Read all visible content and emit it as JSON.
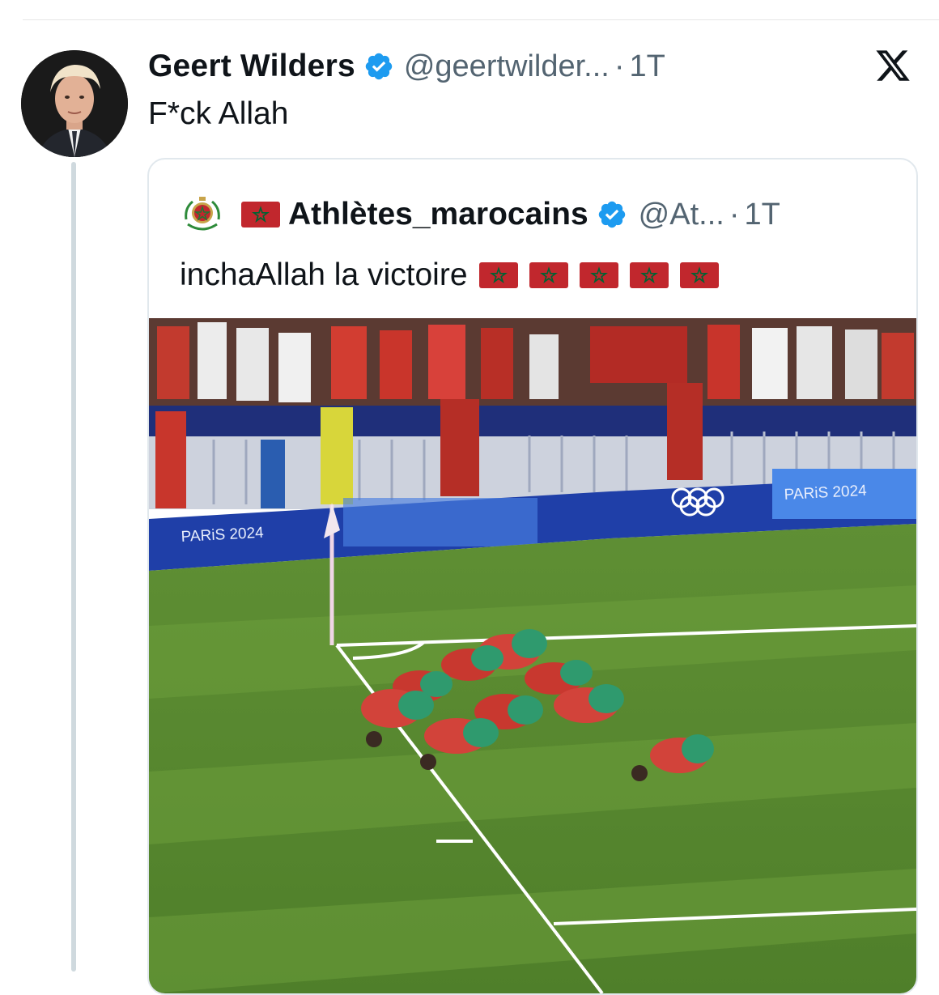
{
  "tweet": {
    "author_name": "Geert Wilders",
    "handle": "@geertwilder...",
    "separator": "·",
    "time": "1T",
    "text": "F*ck Allah"
  },
  "quoted_tweet": {
    "author_name": "Athlètes_marocains",
    "handle": "@At...",
    "separator": "·",
    "time": "1T",
    "text": "inchaAllah la victoire",
    "flag_count_in_text": 5
  },
  "photo": {
    "board_text_left": "PARiS 2024",
    "board_text_right": "PARiS 2024"
  },
  "icons": {
    "verified": "verified-badge-icon",
    "platform": "x-logo-icon",
    "flag": "morocco-flag-icon"
  },
  "colors": {
    "verified_blue": "#1d9bf0",
    "secondary_text": "#536471",
    "flag_red": "#c1272d",
    "flag_star": "#006233"
  }
}
